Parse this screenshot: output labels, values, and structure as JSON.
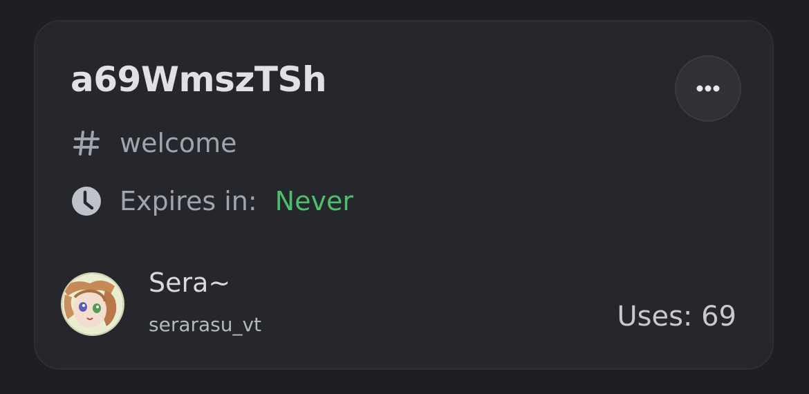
{
  "invite": {
    "code": "a69WmszTSh",
    "channel_symbol": "#",
    "channel_name": "welcome",
    "expires_label": "Expires in:",
    "expires_value": "Never",
    "uses_label": "Uses: 69"
  },
  "inviter": {
    "display_name": "Sera~",
    "username": "serarasu_vt"
  },
  "icons": {
    "more": "more-horizontal-icon",
    "channel": "hash-icon",
    "expires": "clock-icon"
  },
  "colors": {
    "background": "#1e1f22",
    "card": "#26272c",
    "never": "#4dbf6c",
    "muted_text": "#a2a4ad"
  }
}
